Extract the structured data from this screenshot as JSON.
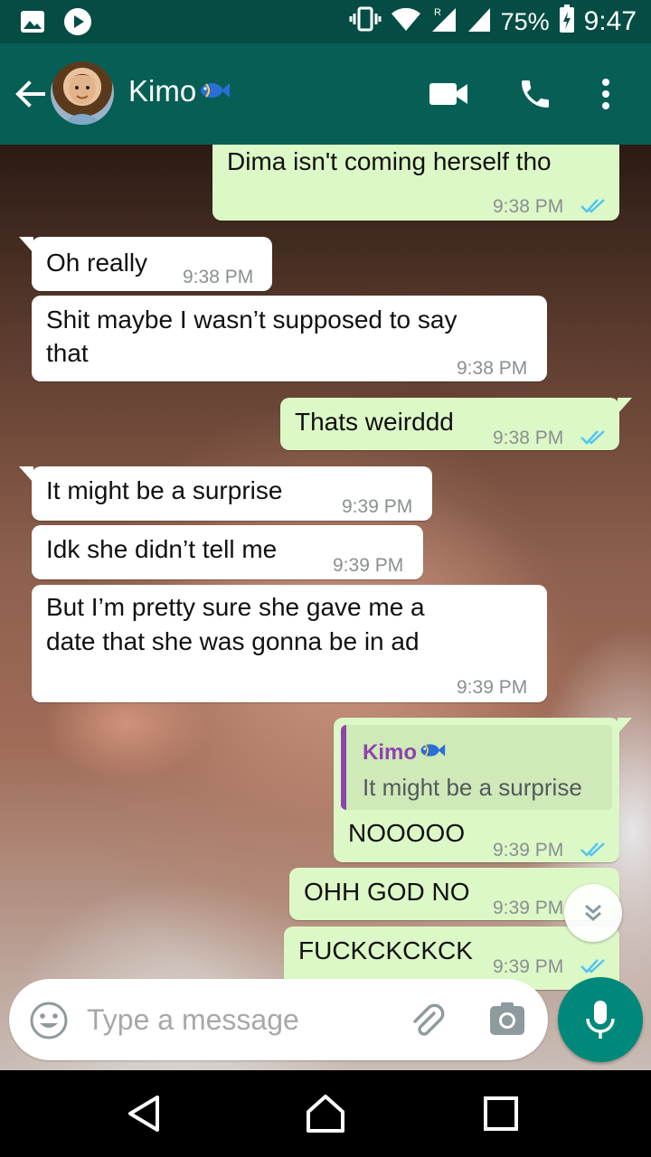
{
  "status_bar": {
    "battery": "75%",
    "time": "9:47",
    "icons": [
      "image-icon",
      "play-icon",
      "vibrate-icon",
      "wifi-icon",
      "signal-roaming-icon",
      "signal-icon",
      "battery-charging-icon"
    ]
  },
  "header": {
    "contact_name": "Kimo",
    "contact_emoji": "fish-emoji",
    "icons": [
      "back-arrow-icon",
      "video-call-icon",
      "phone-icon",
      "more-vert-icon"
    ]
  },
  "messages": [
    {
      "dir": "out",
      "text": "Dima isn't coming herself tho",
      "time": "9:38 PM",
      "read": true
    },
    {
      "dir": "in",
      "text": "Oh really",
      "time": "9:38 PM"
    },
    {
      "dir": "in",
      "lines": [
        "Shit maybe I wasn’t supposed to say",
        "that"
      ],
      "time": "9:38 PM"
    },
    {
      "dir": "out",
      "text": "Thats weirddd",
      "time": "9:38 PM",
      "read": true
    },
    {
      "dir": "in",
      "text": "It might be a surprise",
      "time": "9:39 PM"
    },
    {
      "dir": "in",
      "text": "Idk she didn’t tell me",
      "time": "9:39 PM"
    },
    {
      "dir": "in",
      "lines": [
        "But I’m pretty sure she gave me a",
        "date that she was gonna be in ad"
      ],
      "time": "9:39 PM"
    },
    {
      "dir": "out",
      "quote_name": "Kimo",
      "quote_text": "It might be a surprise",
      "text": "NOOOOO",
      "time": "9:39 PM",
      "read": true
    },
    {
      "dir": "out",
      "text": "OHH GOD NO",
      "time": "9:39 PM",
      "read": true
    },
    {
      "dir": "out",
      "text": "FUCKCKCKCK",
      "time": "9:39 PM",
      "read": true
    }
  ],
  "composer": {
    "placeholder": "Type a message"
  },
  "colors": {
    "header": "#075e54",
    "status_bar": "#054d44",
    "outgoing_bubble": "#dcf8c6",
    "incoming_bubble": "#ffffff",
    "read_ticks": "#4fc3f7",
    "mic_button": "#00897b",
    "quote_accent": "#8e44ad"
  }
}
